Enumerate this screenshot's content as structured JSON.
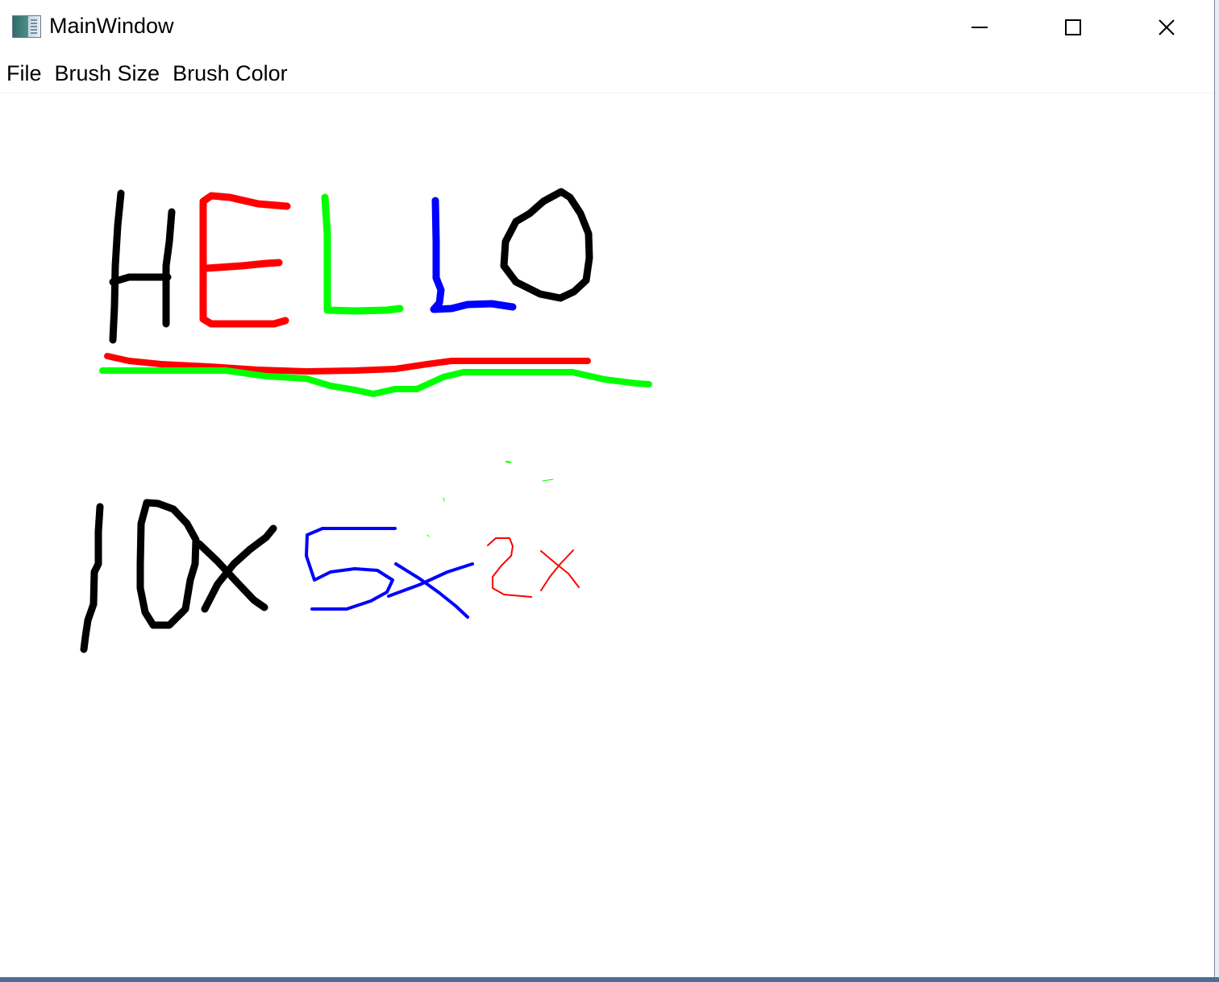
{
  "window": {
    "title": "MainWindow",
    "icon": "app-window-icon"
  },
  "caption_buttons": {
    "minimize_icon": "minimize-icon",
    "maximize_icon": "maximize-icon",
    "close_icon": "close-icon"
  },
  "menu": {
    "items": [
      {
        "label": "File"
      },
      {
        "label": "Brush Size"
      },
      {
        "label": "Brush Color"
      }
    ]
  },
  "drawing": {
    "colors": {
      "black": "#000000",
      "red": "#ff0000",
      "green": "#00ff00",
      "blue": "#0000ff"
    }
  }
}
